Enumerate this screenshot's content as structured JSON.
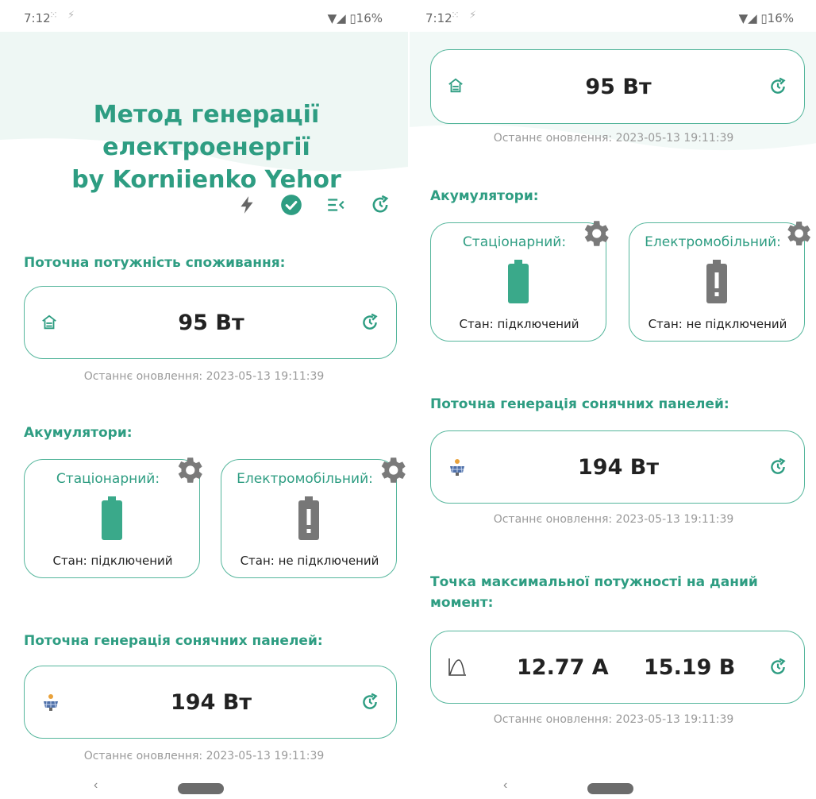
{
  "status": {
    "time": "7:12",
    "battery": "16%"
  },
  "title_line1": "Метод генерації електроенергії",
  "title_line2": "by Korniienko Yehor",
  "sections": {
    "consumption": "Поточна потужність споживання:",
    "accumulators": "Акумулятори:",
    "solar": "Поточна генерація сонячних панелей:",
    "mpp": "Точка максимальної потужності на даний момент:"
  },
  "consumption": {
    "value": "95 Вт",
    "updated": "Останнє оновлення: 2023-05-13 19:11:39"
  },
  "accumulators": {
    "stationary": {
      "name": "Стаціонарний:",
      "state": "Стан: підключений"
    },
    "electromobile": {
      "name": "Електромобільний:",
      "state": "Стан: не підключений"
    }
  },
  "solar": {
    "value": "194 Вт",
    "updated": "Останнє оновлення: 2023-05-13 19:11:39"
  },
  "mpp": {
    "current": "12.77 А",
    "voltage": "15.19 В",
    "updated": "Останнє оновлення: 2023-05-13 19:11:39"
  },
  "icons": {
    "lightning": "lightning-icon",
    "check": "check-circle-icon",
    "list": "menu-collapse-icon",
    "refresh": "refresh-icon",
    "house": "house-icon",
    "solar": "solar-panel-icon",
    "curve": "power-curve-icon",
    "gear": "gear-icon",
    "battery": "battery-icon"
  },
  "colors": {
    "accent": "#2e9d82",
    "border": "#55b69c",
    "battery_on": "#3aa98a",
    "battery_off": "#777777"
  }
}
